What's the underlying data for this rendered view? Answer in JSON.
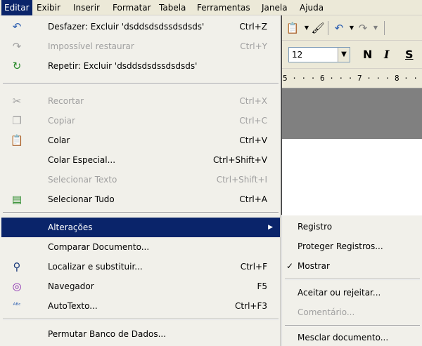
{
  "menubar": {
    "items": [
      "Editar",
      "Exibir",
      "Inserir",
      "Formatar",
      "Tabela",
      "Ferramentas",
      "Janela",
      "Ajuda"
    ],
    "active": "Editar"
  },
  "toolbar": {
    "font_size": "12",
    "bold": "N",
    "italic": "I",
    "underline": "S",
    "ruler_text": "5 · · · 6 · · · 7 · · · 8 · · ·"
  },
  "edit_menu": {
    "items": [
      {
        "icon": "undo-icon",
        "label": "Desfazer: Excluir 'dsddsdsdssdsdsds'",
        "shortcut": "Ctrl+Z",
        "enabled": true
      },
      {
        "icon": "restore-icon",
        "label": "Impossível restaurar",
        "shortcut": "Ctrl+Y",
        "enabled": false
      },
      {
        "icon": "repeat-icon",
        "label": "Repetir: Excluir 'dsddsdsdssdsdsds'",
        "shortcut": "",
        "enabled": true
      },
      {
        "icon": "cut-icon",
        "label": "Recortar",
        "shortcut": "Ctrl+X",
        "enabled": false
      },
      {
        "icon": "copy-icon",
        "label": "Copiar",
        "shortcut": "Ctrl+C",
        "enabled": false
      },
      {
        "icon": "paste-icon",
        "label": "Colar",
        "shortcut": "Ctrl+V",
        "enabled": true
      },
      {
        "icon": "",
        "label": "Colar Especial...",
        "shortcut": "Ctrl+Shift+V",
        "enabled": true
      },
      {
        "icon": "",
        "label": "Selecionar Texto",
        "shortcut": "Ctrl+Shift+I",
        "enabled": false
      },
      {
        "icon": "select-all-icon",
        "label": "Selecionar Tudo",
        "shortcut": "Ctrl+A",
        "enabled": true
      },
      {
        "icon": "",
        "label": "Alterações",
        "shortcut": "",
        "enabled": true,
        "highlighted": true,
        "submenu": true
      },
      {
        "icon": "",
        "label": "Comparar Documento...",
        "shortcut": "",
        "enabled": true
      },
      {
        "icon": "binoculars-icon",
        "label": "Localizar e substituir...",
        "shortcut": "Ctrl+F",
        "enabled": true
      },
      {
        "icon": "navigator-icon",
        "label": "Navegador",
        "shortcut": "F5",
        "enabled": true
      },
      {
        "icon": "autotext-icon",
        "label": "AutoTexto...",
        "shortcut": "Ctrl+F3",
        "enabled": true
      },
      {
        "icon": "",
        "label": "Permutar Banco de Dados...",
        "shortcut": "",
        "enabled": true
      }
    ]
  },
  "changes_submenu": {
    "items": [
      {
        "label": "Registro",
        "checked": false,
        "enabled": true
      },
      {
        "label": "Proteger Registros...",
        "checked": false,
        "enabled": true
      },
      {
        "label": "Mostrar",
        "checked": true,
        "enabled": true
      },
      {
        "label": "Aceitar ou rejeitar...",
        "checked": false,
        "enabled": true
      },
      {
        "label": "Comentário...",
        "checked": false,
        "enabled": false
      },
      {
        "label": "Mesclar documento...",
        "checked": false,
        "enabled": true
      }
    ],
    "checkmark": "✓"
  }
}
